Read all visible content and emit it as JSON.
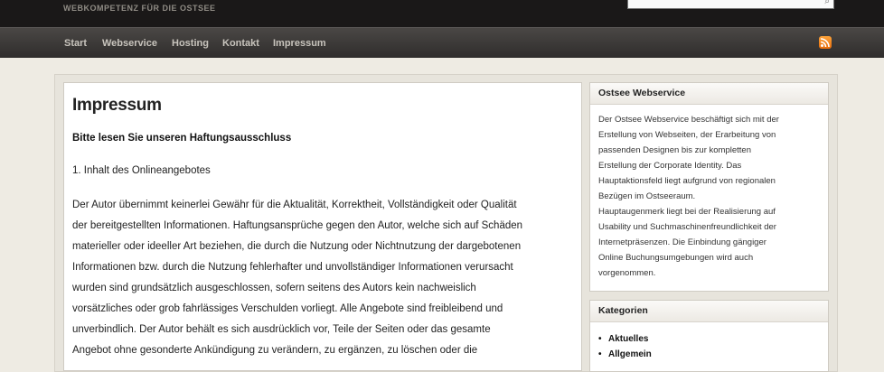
{
  "header": {
    "tagline": "WEBKOMPETENZ FÜR DIE OSTSEE",
    "search_value": "",
    "search_icon": "search-icon"
  },
  "nav": {
    "items": [
      "Start",
      "Webservice",
      "Hosting",
      "Kontakt",
      "Impressum"
    ],
    "rss_icon": "rss-icon"
  },
  "main": {
    "title": "Impressum",
    "subheading": "Bitte lesen Sie unseren Haftungsausschluss",
    "section_heading": "1. Inhalt des Onlineangebotes",
    "paragraph_lines": [
      "Der Autor übernimmt keinerlei Gewähr für die Aktualität, Korrektheit, Vollständigkeit oder Qualität",
      "der bereitgestellten Informationen. Haftungsansprüche gegen den Autor, welche sich auf Schäden",
      "materieller oder ideeller Art beziehen, die durch die Nutzung oder Nichtnutzung der dargebotenen",
      "Informationen bzw. durch die Nutzung fehlerhafter und unvollständiger Informationen verursacht",
      "wurden sind grundsätzlich ausgeschlossen, sofern seitens des Autors kein nachweislich",
      "vorsätzliches oder grob fahrlässiges Verschulden vorliegt. Alle Angebote sind freibleibend und",
      "unverbindlich. Der Autor behält es sich ausdrücklich vor, Teile der Seiten oder das gesamte",
      "Angebot ohne gesonderte Ankündigung zu verändern, zu ergänzen, zu löschen oder die"
    ]
  },
  "sidebar": {
    "about": {
      "title": "Ostsee Webservice",
      "lines": [
        "Der Ostsee Webservice beschäftigt sich mit der",
        "Erstellung von Webseiten, der Erarbeitung von",
        "passenden Designen bis zur kompletten",
        "Erstellung der Corporate Identity. Das",
        "Hauptaktionsfeld liegt aufgrund von regionalen",
        "Bezügen im Ostseeraum.",
        "Hauptaugenmerk liegt bei der Realisierung auf",
        "Usability und Suchmaschinenfreundlichkeit der",
        "Internetpräsenzen. Die Einbindung gängiger",
        "Online Buchungsumgebungen wird auch",
        "vorgenommen."
      ]
    },
    "categories": {
      "title": "Kategorien",
      "items": [
        "Aktuelles",
        "Allgemein"
      ]
    }
  }
}
